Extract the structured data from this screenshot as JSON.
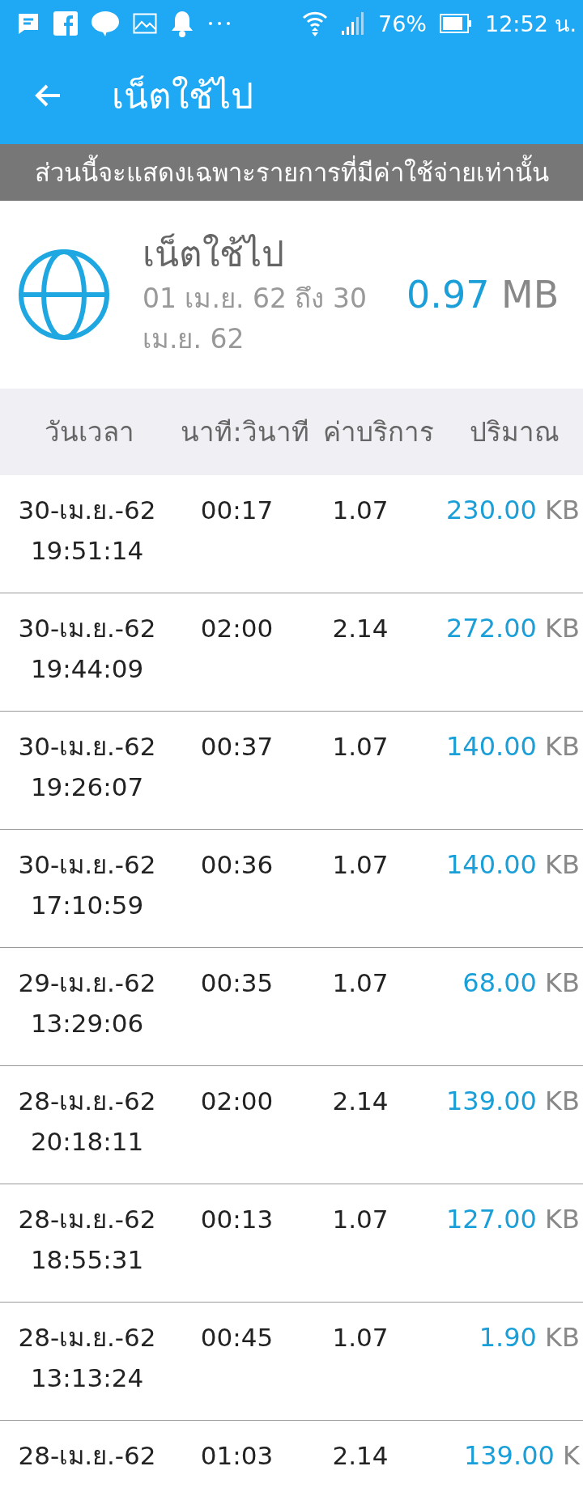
{
  "status_bar": {
    "battery": "76%",
    "time": "12:52 น."
  },
  "app_bar": {
    "title": "เน็ตใช้ไป"
  },
  "notice": "ส่วนนี้จะแสดงเฉพาะรายการที่มีค่าใช้จ่ายเท่านั้น",
  "summary": {
    "title": "เน็ตใช้ไป",
    "period": "01 เม.ย. 62 ถึง 30 เม.ย. 62",
    "total": "0.97",
    "unit": "MB"
  },
  "table": {
    "columns": [
      "วันเวลา",
      "นาที:วินาที",
      "ค่าบริการ",
      "ปริมาณ"
    ],
    "rows": [
      {
        "date": "30-เม.ย.-62",
        "time": "19:51:14",
        "duration": "00:17",
        "fee": "1.07",
        "amount": "230.00",
        "unit": "KB"
      },
      {
        "date": "30-เม.ย.-62",
        "time": "19:44:09",
        "duration": "02:00",
        "fee": "2.14",
        "amount": "272.00",
        "unit": "KB"
      },
      {
        "date": "30-เม.ย.-62",
        "time": "19:26:07",
        "duration": "00:37",
        "fee": "1.07",
        "amount": "140.00",
        "unit": "KB"
      },
      {
        "date": "30-เม.ย.-62",
        "time": "17:10:59",
        "duration": "00:36",
        "fee": "1.07",
        "amount": "140.00",
        "unit": "KB"
      },
      {
        "date": "29-เม.ย.-62",
        "time": "13:29:06",
        "duration": "00:35",
        "fee": "1.07",
        "amount": "68.00",
        "unit": "KB"
      },
      {
        "date": "28-เม.ย.-62",
        "time": "20:18:11",
        "duration": "02:00",
        "fee": "2.14",
        "amount": "139.00",
        "unit": "KB"
      },
      {
        "date": "28-เม.ย.-62",
        "time": "18:55:31",
        "duration": "00:13",
        "fee": "1.07",
        "amount": "127.00",
        "unit": "KB"
      },
      {
        "date": "28-เม.ย.-62",
        "time": "13:13:24",
        "duration": "00:45",
        "fee": "1.07",
        "amount": "1.90",
        "unit": "KB"
      },
      {
        "date": "28-เม.ย.-62",
        "duration": "01:03",
        "fee": "2.14",
        "amount": "139.00",
        "unit": "K"
      }
    ]
  }
}
